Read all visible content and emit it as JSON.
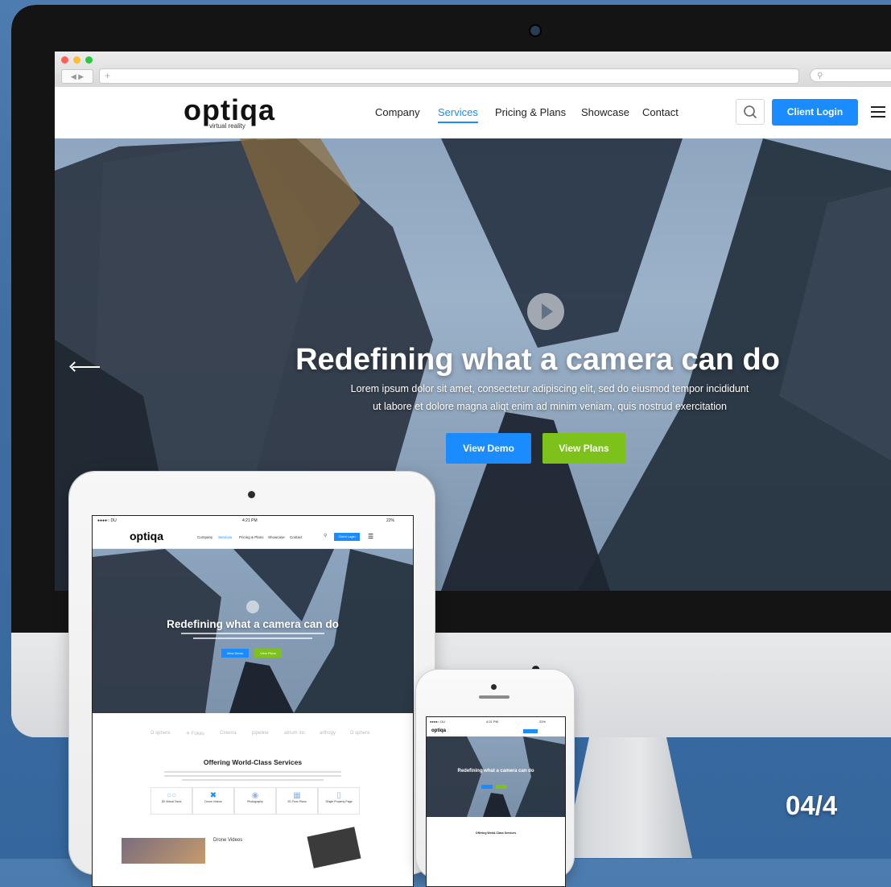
{
  "site": {
    "logo": "optiqa",
    "logo_tagline": "virtual reality",
    "nav": [
      "Company",
      "Services",
      "Pricing & Plans",
      "Showcase",
      "Contact"
    ],
    "active_nav": "Services",
    "login_label": "Client Login",
    "browser_search_placeholder": "Q"
  },
  "hero": {
    "title": "Redefining what a camera can do",
    "text_line1": "Lorem ipsum dolor sit amet, consectetur adipiscing elit, sed do eiusmod tempor incididunt",
    "text_line2": "ut labore et dolore magna aliqt enim ad minim veniam, quis nostrud exercitation",
    "demo_label": "View Demo",
    "plans_label": "View Plans"
  },
  "tablet": {
    "status_carrier": "●●●●○ DU  ",
    "status_time": "4:21 PM",
    "status_battery": "22%",
    "logo": "optiqa",
    "nav": [
      "Company",
      "Services",
      "Pricing & Plans",
      "Showcase",
      "Contact"
    ],
    "login_label": "Client Login",
    "hero_title": "Redefining what a camera can do",
    "demo_label": "View Demo",
    "plans_label": "View Plans",
    "section_title": "Offering World-Class Services",
    "tabs": [
      "3D Virtual Tours",
      "Drone Videos",
      "Photography",
      "2D Floor Plans",
      "Single Property Page"
    ],
    "drone_heading": "Drone Videos"
  },
  "phone": {
    "status_carrier": "●●●●○ DU",
    "status_time": "4:21 PM",
    "status_battery": "22%",
    "hero_title": "Redefining what a camera can do",
    "section_title": "Offering World-Class Services"
  },
  "slide_counter": "04/4",
  "colors": {
    "accent_blue": "#1a8cff",
    "accent_green": "#7dc21a",
    "background": "#3f6ea2"
  }
}
